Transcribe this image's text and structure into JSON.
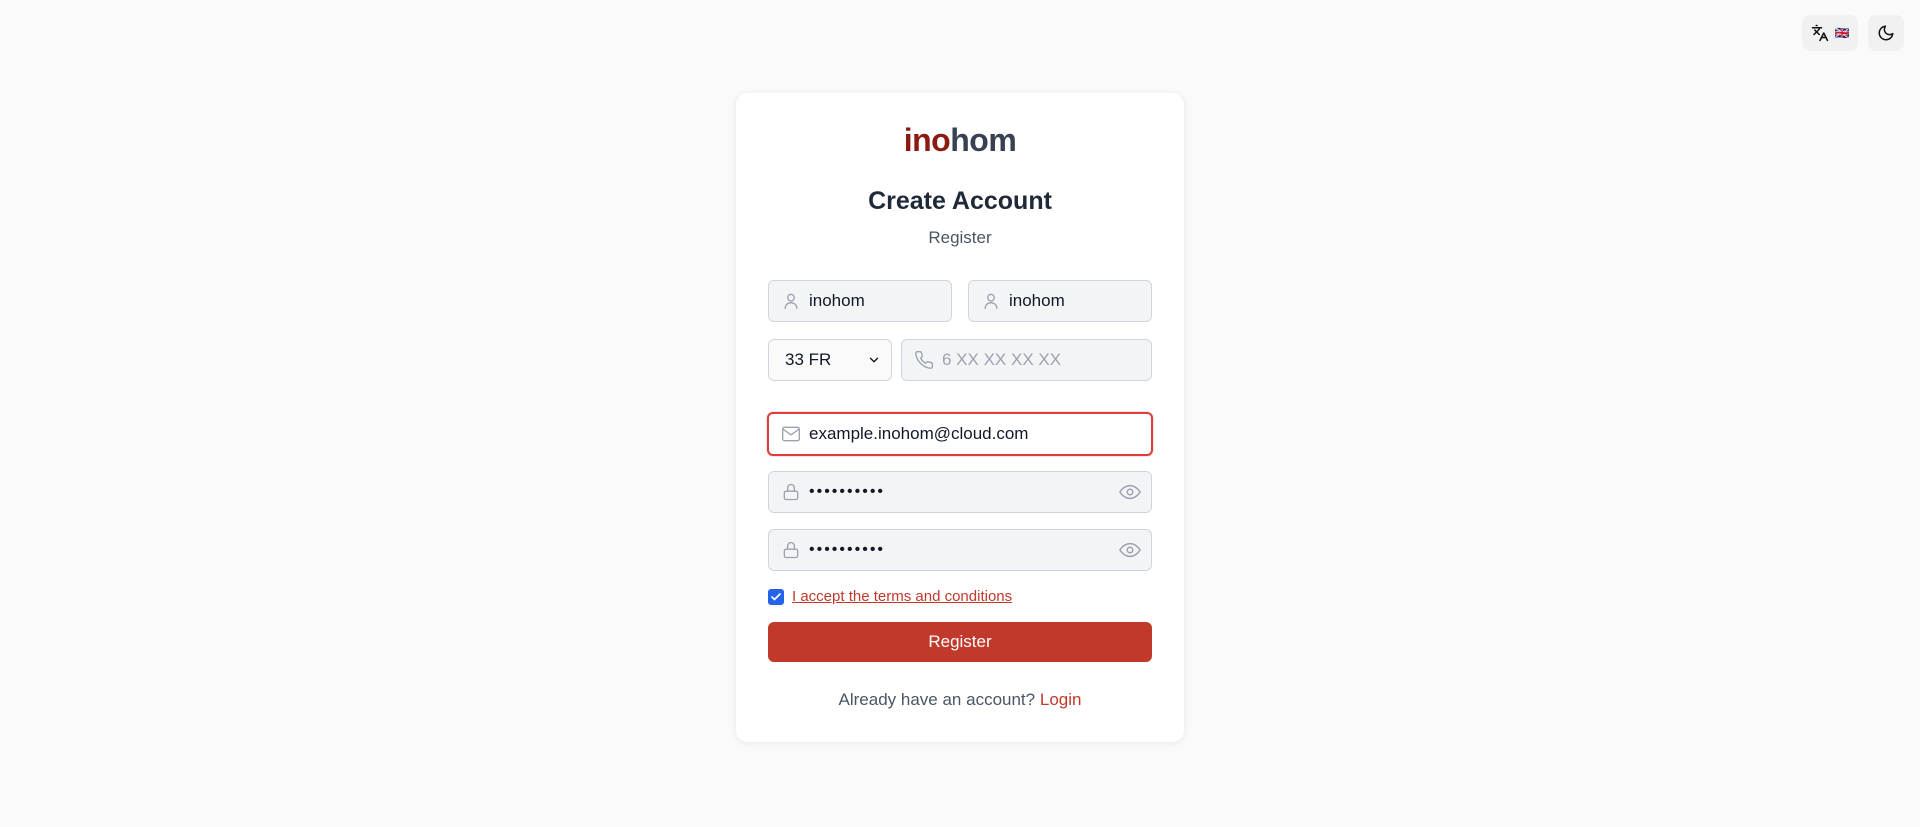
{
  "topbar": {
    "language_flag": "🇬🇧",
    "language_icon": "translate-icon",
    "theme_icon": "moon-icon"
  },
  "brand": {
    "logo_part1": "ino",
    "logo_part2": "hom",
    "accent_color": "#8b1a10",
    "button_color": "#c0392b"
  },
  "header": {
    "title": "Create Account",
    "subtitle": "Register"
  },
  "form": {
    "first_name": {
      "value": "inohom"
    },
    "last_name": {
      "value": "inohom"
    },
    "country_code": {
      "selected": "33 FR"
    },
    "phone": {
      "value": "",
      "placeholder": "6 XX XX XX XX"
    },
    "email": {
      "value": "example.inohom@cloud.com"
    },
    "password": {
      "value": "••••••••••"
    },
    "confirm_password": {
      "value": "••••••••••"
    },
    "terms_label": "I accept the terms and conditions",
    "terms_checked": true,
    "submit_label": "Register"
  },
  "footer": {
    "prompt": "Already have an account?",
    "login_label": "Login"
  }
}
